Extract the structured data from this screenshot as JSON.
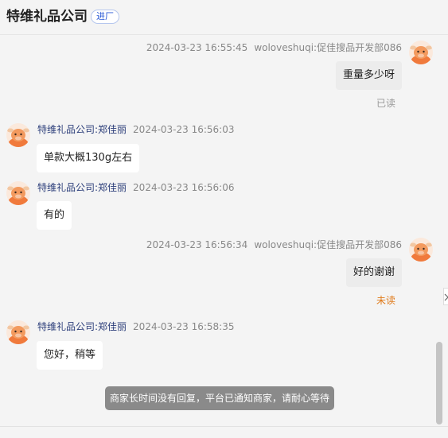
{
  "header": {
    "shop_name": "特维礼品公司",
    "enter_shop_label": "进厂"
  },
  "messages": [
    {
      "side": "right",
      "time": "2024-03-23 16:55:45",
      "sender": "woloveshuqi:促佳搜品开发部086",
      "text": "重量多少呀",
      "status": "已读"
    },
    {
      "side": "left",
      "sender": "特维礼品公司:郑佳丽",
      "time": "2024-03-23 16:56:03",
      "text": "单款大概130g左右"
    },
    {
      "side": "left",
      "sender": "特维礼品公司:郑佳丽",
      "time": "2024-03-23 16:56:06",
      "text": "有的"
    },
    {
      "side": "right",
      "time": "2024-03-23 16:56:34",
      "sender": "woloveshuqi:促佳搜品开发部086",
      "text": "好的谢谢",
      "status": "未读"
    },
    {
      "side": "left",
      "sender": "特维礼品公司:郑佳丽",
      "time": "2024-03-23 16:58:35",
      "text": "您好，稍等"
    }
  ],
  "toast": "商家长时间没有回复，平台已通知商家，请耐心等待",
  "colors": {
    "background": "#f4f4f4",
    "sender_name": "#2c3e7a",
    "unread": "#e07a1a",
    "badge": "#2a5ad6",
    "avatar": "#f07a3c"
  },
  "icons": {
    "avatar": "cartoon-cow-avatar-icon",
    "side_toggle": "chevron-right-icon"
  }
}
